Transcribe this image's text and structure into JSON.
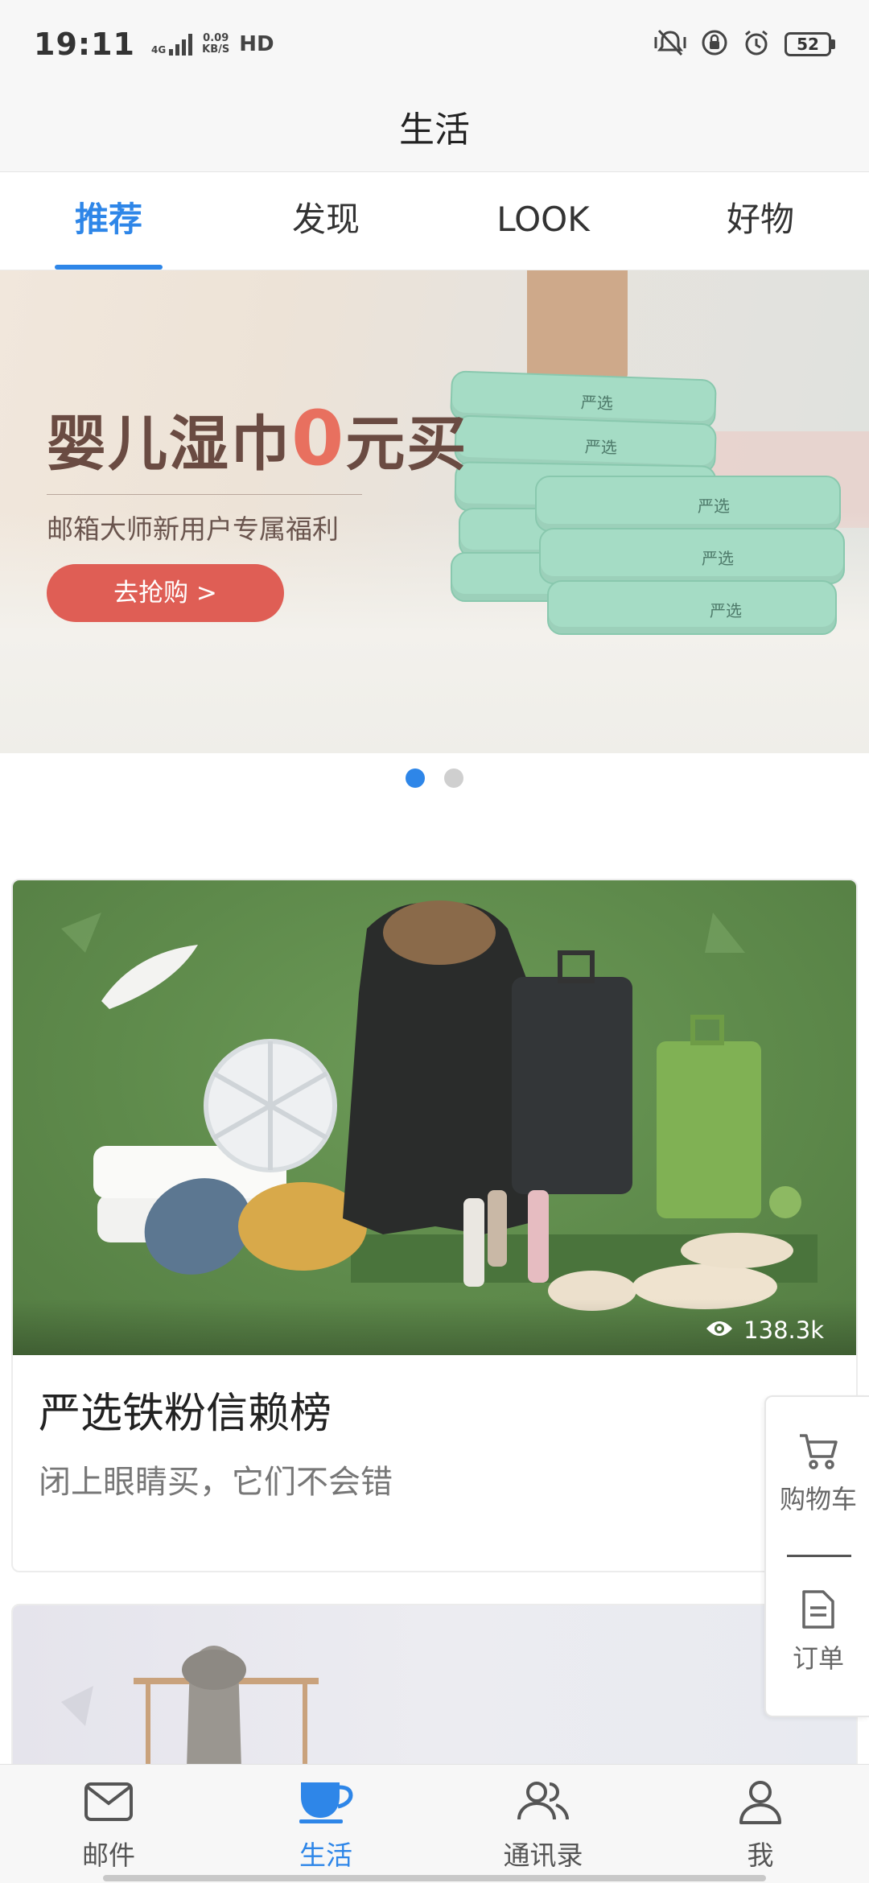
{
  "status_bar": {
    "time": "19:11",
    "network": "4G",
    "speed_value": "0.09",
    "speed_unit": "KB/S",
    "hd": "HD",
    "battery": "52"
  },
  "header": {
    "title": "生活"
  },
  "tabs": [
    {
      "label": "推荐",
      "active": true
    },
    {
      "label": "发现",
      "active": false
    },
    {
      "label": "LOOK",
      "active": false
    },
    {
      "label": "好物",
      "active": false
    }
  ],
  "banner": {
    "headline_prefix": "婴儿湿巾",
    "headline_highlight": "0",
    "headline_suffix": "元买",
    "subtitle": "邮箱大师新用户专属福利",
    "cta": "去抢购 >",
    "product_label": "严选",
    "page_count": 2,
    "current_page": 1
  },
  "cards": [
    {
      "title": "严选铁粉信赖榜",
      "subtitle": "闭上眼睛买，它们不会错",
      "views": "138.3k"
    }
  ],
  "side_panel": {
    "cart_label": "购物车",
    "orders_label": "订单"
  },
  "bottom_nav": [
    {
      "label": "邮件",
      "icon": "mail-icon",
      "active": false
    },
    {
      "label": "生活",
      "icon": "cup-icon",
      "active": true
    },
    {
      "label": "通讯录",
      "icon": "contacts-icon",
      "active": false
    },
    {
      "label": "我",
      "icon": "profile-icon",
      "active": false
    }
  ],
  "colors": {
    "accent": "#2e86e8",
    "cta": "#df5e55",
    "card_image_bg": "#5e8a4b"
  }
}
